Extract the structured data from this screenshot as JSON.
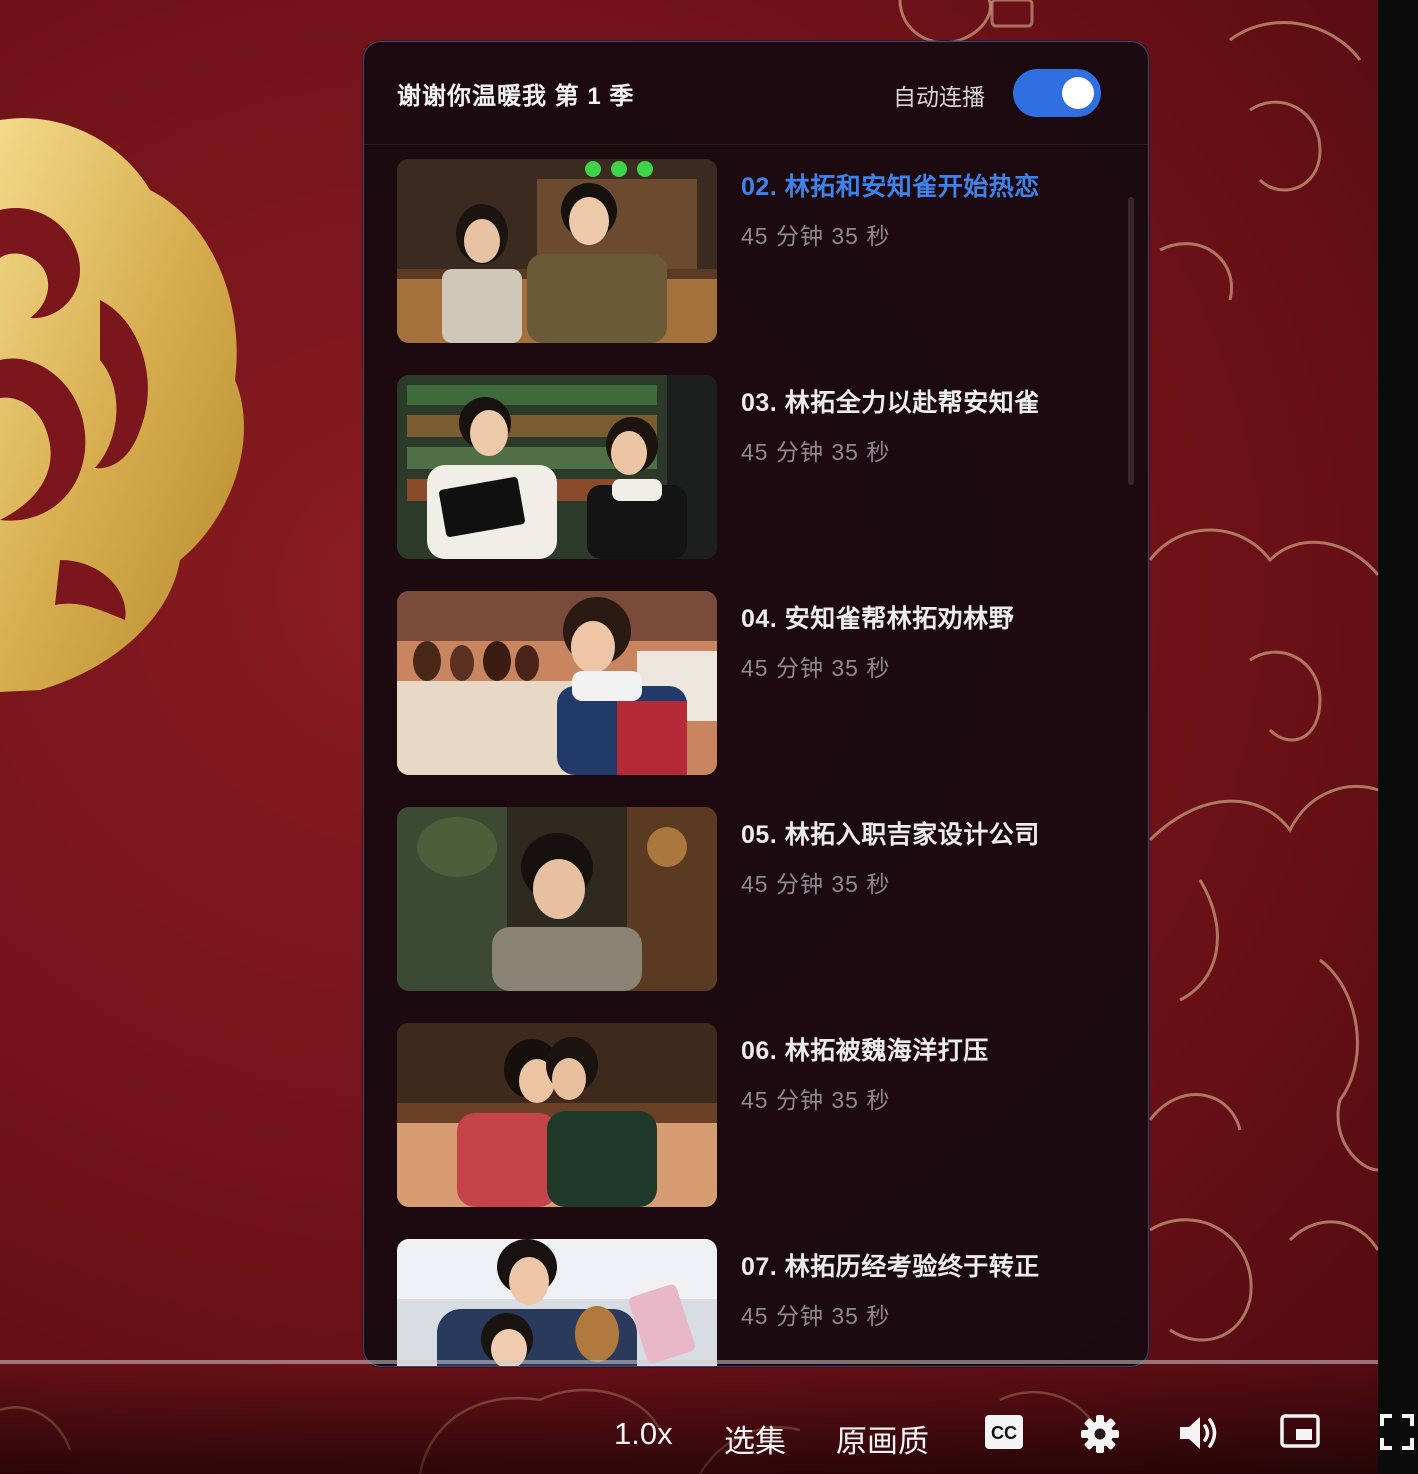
{
  "panel": {
    "title": "谢谢你温暖我 第 1 季",
    "autoplay_label": "自动连播",
    "autoplay_on": true
  },
  "episodes": [
    {
      "title": "02. 林拓和安知雀开始热恋",
      "duration": "45 分钟 35 秒",
      "active": true
    },
    {
      "title": "03. 林拓全力以赴帮安知雀",
      "duration": "45 分钟 35 秒",
      "active": false
    },
    {
      "title": "04. 安知雀帮林拓劝林野",
      "duration": "45 分钟 35 秒",
      "active": false
    },
    {
      "title": "05. 林拓入职吉家设计公司",
      "duration": "45 分钟 35 秒",
      "active": false
    },
    {
      "title": "06. 林拓被魏海洋打压",
      "duration": "45 分钟 35 秒",
      "active": false
    },
    {
      "title": "07. 林拓历经考验终于转正",
      "duration": "45 分钟 35 秒",
      "active": false
    }
  ],
  "controls": {
    "speed": "1.0x",
    "episodes": "选集",
    "quality": "原画质",
    "icons": [
      "captions-icon",
      "settings-gear-icon",
      "volume-icon",
      "picture-in-picture-icon",
      "fullscreen-icon"
    ]
  },
  "colors": {
    "accent": "#3f83ea",
    "toggle": "#2f6fe0",
    "background": "#6e1218",
    "gold": "#d9b85a"
  }
}
